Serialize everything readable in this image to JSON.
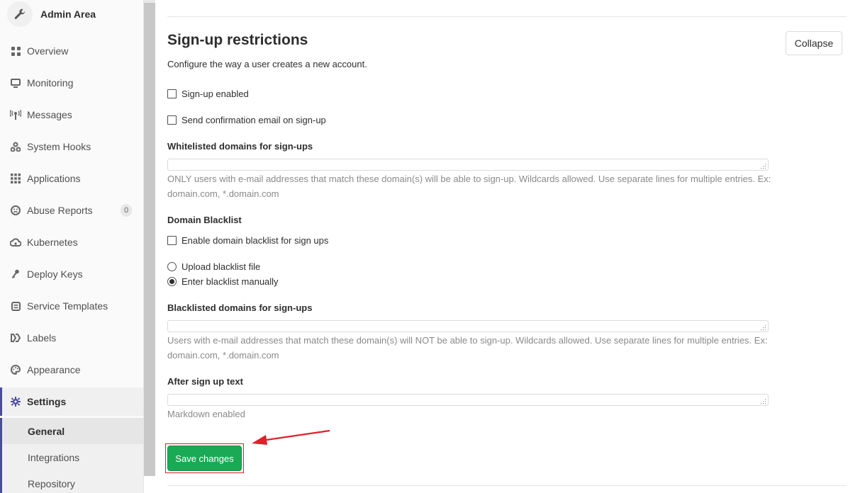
{
  "sidebar": {
    "title": "Admin Area",
    "items": [
      {
        "label": "Overview",
        "icon": "grid-icon"
      },
      {
        "label": "Monitoring",
        "icon": "monitor-icon"
      },
      {
        "label": "Messages",
        "icon": "broadcast-icon"
      },
      {
        "label": "System Hooks",
        "icon": "hook-icon"
      },
      {
        "label": "Applications",
        "icon": "apps-grid-icon"
      },
      {
        "label": "Abuse Reports",
        "icon": "face-icon",
        "badge": "0"
      },
      {
        "label": "Kubernetes",
        "icon": "cloud-gear-icon"
      },
      {
        "label": "Deploy Keys",
        "icon": "key-icon"
      },
      {
        "label": "Service Templates",
        "icon": "template-icon"
      },
      {
        "label": "Labels",
        "icon": "labels-icon"
      },
      {
        "label": "Appearance",
        "icon": "palette-icon"
      },
      {
        "label": "Settings",
        "icon": "gear-icon"
      }
    ],
    "subitems": [
      {
        "label": "General"
      },
      {
        "label": "Integrations"
      },
      {
        "label": "Repository"
      }
    ]
  },
  "main": {
    "section_title": "Sign-up restrictions",
    "section_desc": "Configure the way a user creates a new account.",
    "collapse_label": "Collapse",
    "signup_enabled": "Sign-up enabled",
    "send_confirmation": "Send confirmation email on sign-up",
    "whitelist_label": "Whitelisted domains for sign-ups",
    "whitelist_help": "ONLY users with e-mail addresses that match these domain(s) will be able to sign-up. Wildcards allowed. Use separate lines for multiple entries. Ex: domain.com, *.domain.com",
    "blacklist_heading": "Domain Blacklist",
    "enable_blacklist": "Enable domain blacklist for sign ups",
    "upload_blacklist": "Upload blacklist file",
    "enter_blacklist": "Enter blacklist manually",
    "blacklisted_label": "Blacklisted domains for sign-ups",
    "blacklisted_help": "Users with e-mail addresses that match these domain(s) will NOT be able to sign-up. Wildcards allowed. Use separate lines for multiple entries. Ex: domain.com, *.domain.com",
    "after_signup_label": "After sign up text",
    "markdown_help": "Markdown enabled",
    "save_label": "Save changes"
  },
  "colors": {
    "accent": "#4b4ba3",
    "save_green": "#1aaa55",
    "annotation_red": "#e0202a"
  }
}
